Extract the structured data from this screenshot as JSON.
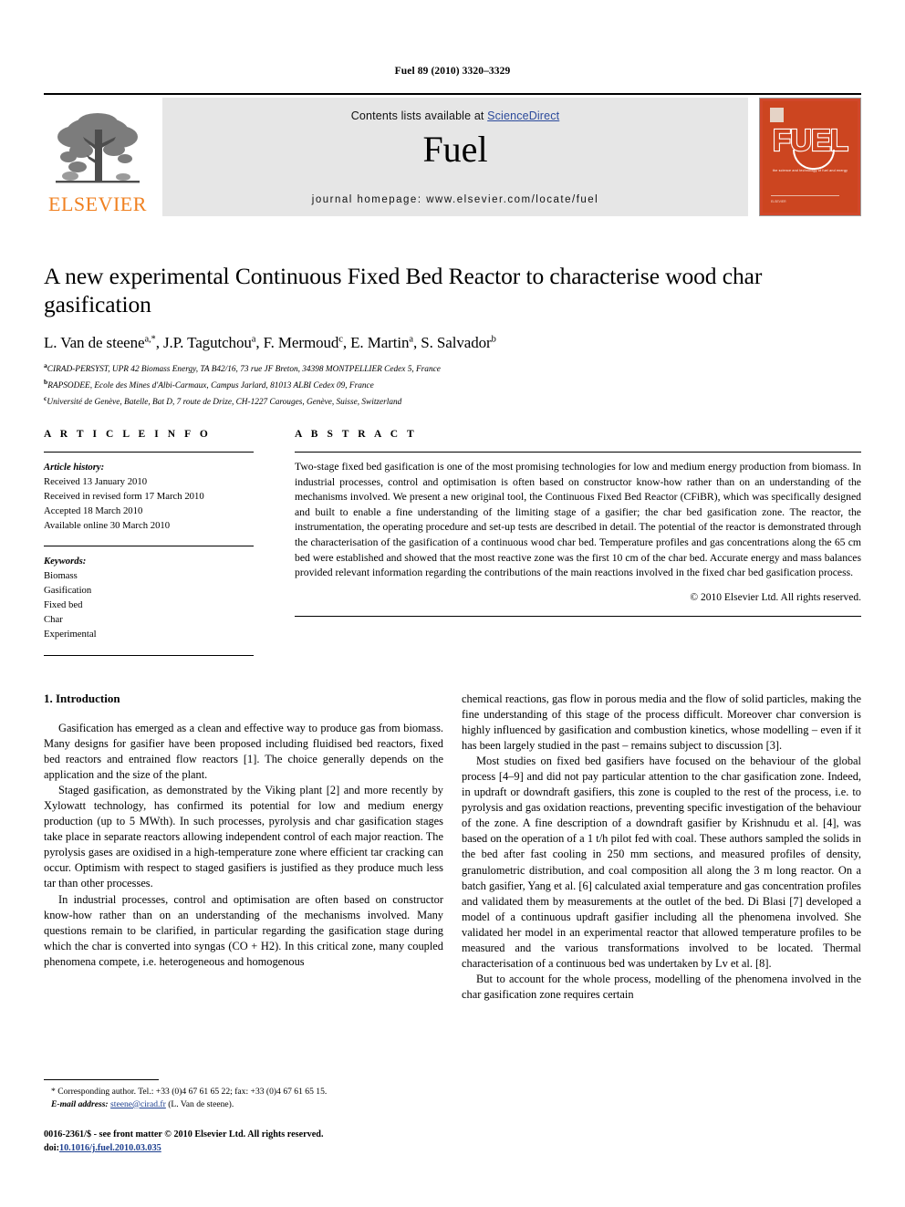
{
  "running_head": "Fuel 89 (2010) 3320–3329",
  "header": {
    "contents_prefix": "Contents lists available at ",
    "sciencedirect": "ScienceDirect",
    "journal_title": "Fuel",
    "homepage": "journal homepage: www.elsevier.com/locate/fuel",
    "publisher_wordmark": "ELSEVIER",
    "cover": {
      "title": "FUEL",
      "subtitle": "the science and technology of fuel and energy",
      "footer": "ELSEVIER"
    },
    "colors": {
      "elsevier_orange": "#f08020",
      "band_gray": "#e6e6e6",
      "link_blue": "#2b4a9b",
      "cover_red": "#cc4520"
    }
  },
  "article": {
    "title": "A new experimental Continuous Fixed Bed Reactor to characterise wood char gasification",
    "authors": "L. Van de steene a,*, J.P. Tagutchou a, F. Mermoud c, E. Martin a, S. Salvador b",
    "authors_parts": [
      {
        "name": "L. Van de steene",
        "sup": "a,*"
      },
      {
        "name": "J.P. Tagutchou",
        "sup": "a"
      },
      {
        "name": "F. Mermoud",
        "sup": "c"
      },
      {
        "name": "E. Martin",
        "sup": "a"
      },
      {
        "name": "S. Salvador",
        "sup": "b"
      }
    ],
    "affiliations": [
      {
        "label": "a",
        "text": "CIRAD-PERSYST, UPR 42 Biomass Energy, TA B42/16, 73 rue JF Breton, 34398 MONTPELLIER Cedex 5, France"
      },
      {
        "label": "b",
        "text": "RAPSODEE, Ecole des Mines d'Albi-Carmaux, Campus Jarlard, 81013 ALBI Cedex 09, France"
      },
      {
        "label": "c",
        "text": "Université de Genève, Batelle, Bat D, 7 route de Drize, CH-1227 Carouges, Genève, Suisse, Switzerland"
      }
    ]
  },
  "article_info": {
    "heading": "A R T I C L E    I N F O",
    "history_label": "Article history:",
    "history": [
      "Received 13 January 2010",
      "Received in revised form 17 March 2010",
      "Accepted 18 March 2010",
      "Available online 30 March 2010"
    ],
    "keywords_label": "Keywords:",
    "keywords": [
      "Biomass",
      "Gasification",
      "Fixed bed",
      "Char",
      "Experimental"
    ]
  },
  "abstract": {
    "heading": "A B S T R A C T",
    "text": "Two-stage fixed bed gasification is one of the most promising technologies for low and medium energy production from biomass. In industrial processes, control and optimisation is often based on constructor know-how rather than on an understanding of the mechanisms involved. We present a new original tool, the Continuous Fixed Bed Reactor (CFiBR), which was specifically designed and built to enable a fine understanding of the limiting stage of a gasifier; the char bed gasification zone. The reactor, the instrumentation, the operating procedure and set-up tests are described in detail. The potential of the reactor is demonstrated through the characterisation of the gasification of a continuous wood char bed. Temperature profiles and gas concentrations along the 65 cm bed were established and showed that the most reactive zone was the first 10 cm of the char bed. Accurate energy and mass balances provided relevant information regarding the contributions of the main reactions involved in the fixed char bed gasification process.",
    "copyright": "© 2010 Elsevier Ltd. All rights reserved."
  },
  "body": {
    "section_title": "1. Introduction",
    "left_paragraphs": [
      "Gasification has emerged as a clean and effective way to produce gas from biomass. Many designs for gasifier have been proposed including fluidised bed reactors, fixed bed reactors and entrained flow reactors [1]. The choice generally depends on the application and the size of the plant.",
      "Staged gasification, as demonstrated by the Viking plant [2] and more recently by Xylowatt technology, has confirmed its potential for low and medium energy production (up to 5 MWth). In such processes, pyrolysis and char gasification stages take place in separate reactors allowing independent control of each major reaction. The pyrolysis gases are oxidised in a high-temperature zone where efficient tar cracking can occur. Optimism with respect to staged gasifiers is justified as they produce much less tar than other processes.",
      "In industrial processes, control and optimisation are often based on constructor know-how rather than on an understanding of the mechanisms involved. Many questions remain to be clarified, in particular regarding the gasification stage during which the char is converted into syngas (CO + H2). In this critical zone, many coupled phenomena compete, i.e. heterogeneous and homogenous"
    ],
    "right_paragraphs": [
      "chemical reactions, gas flow in porous media and the flow of solid particles, making the fine understanding of this stage of the process difficult. Moreover char conversion is highly influenced by gasification and combustion kinetics, whose modelling – even if it has been largely studied in the past – remains subject to discussion [3].",
      "Most studies on fixed bed gasifiers have focused on the behaviour of the global process [4–9] and did not pay particular attention to the char gasification zone. Indeed, in updraft or downdraft gasifiers, this zone is coupled to the rest of the process, i.e. to pyrolysis and gas oxidation reactions, preventing specific investigation of the behaviour of the zone. A fine description of a downdraft gasifier by Krishnudu et al. [4], was based on the operation of a 1 t/h pilot fed with coal. These authors sampled the solids in the bed after fast cooling in 250 mm sections, and measured profiles of density, granulometric distribution, and coal composition all along the 3 m long reactor. On a batch gasifier, Yang et al. [6] calculated axial temperature and gas concentration profiles and validated them by measurements at the outlet of the bed. Di Blasi [7] developed a model of a continuous updraft gasifier including all the phenomena involved. She validated her model in an experimental reactor that allowed temperature profiles to be measured and the various transformations involved to be located. Thermal characterisation of a continuous bed was undertaken by Lv et al. [8].",
      "But to account for the whole process, modelling of the phenomena involved in the char gasification zone requires certain"
    ]
  },
  "footnotes": {
    "corresponding": "* Corresponding author. Tel.: +33 (0)4 67 61 65 22; fax: +33 (0)4 67 61 65 15.",
    "email_label": "E-mail address:",
    "email": "steene@cirad.fr",
    "email_suffix": "(L. Van de steene).",
    "imprint_line1": "0016-2361/$ - see front matter © 2010 Elsevier Ltd. All rights reserved.",
    "doi_label": "doi:",
    "doi": "10.1016/j.fuel.2010.03.035"
  }
}
